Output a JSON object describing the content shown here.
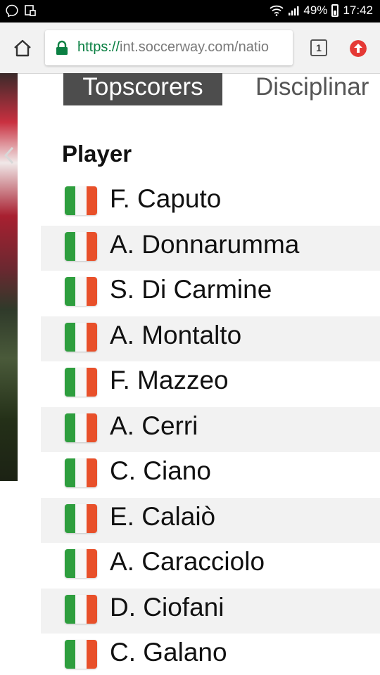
{
  "status_bar": {
    "battery": "49%",
    "time": "17:42"
  },
  "browser": {
    "url_scheme": "https://",
    "url_rest": "int.soccerway.com/natio",
    "tab_count": "1"
  },
  "tabs": {
    "active": "Topscorers",
    "inactive": "Disciplinar"
  },
  "table": {
    "header": "Player",
    "flag_colors": [
      "#2e9e3e",
      "#f7f7f7",
      "#e8502a"
    ],
    "players": [
      "F. Caputo",
      "A. Donnarumma",
      "S. Di Carmine",
      "A. Montalto",
      "F. Mazzeo",
      "A. Cerri",
      "C. Ciano",
      "E. Calaiò",
      "A. Caracciolo",
      "D. Ciofani",
      "C. Galano"
    ]
  }
}
